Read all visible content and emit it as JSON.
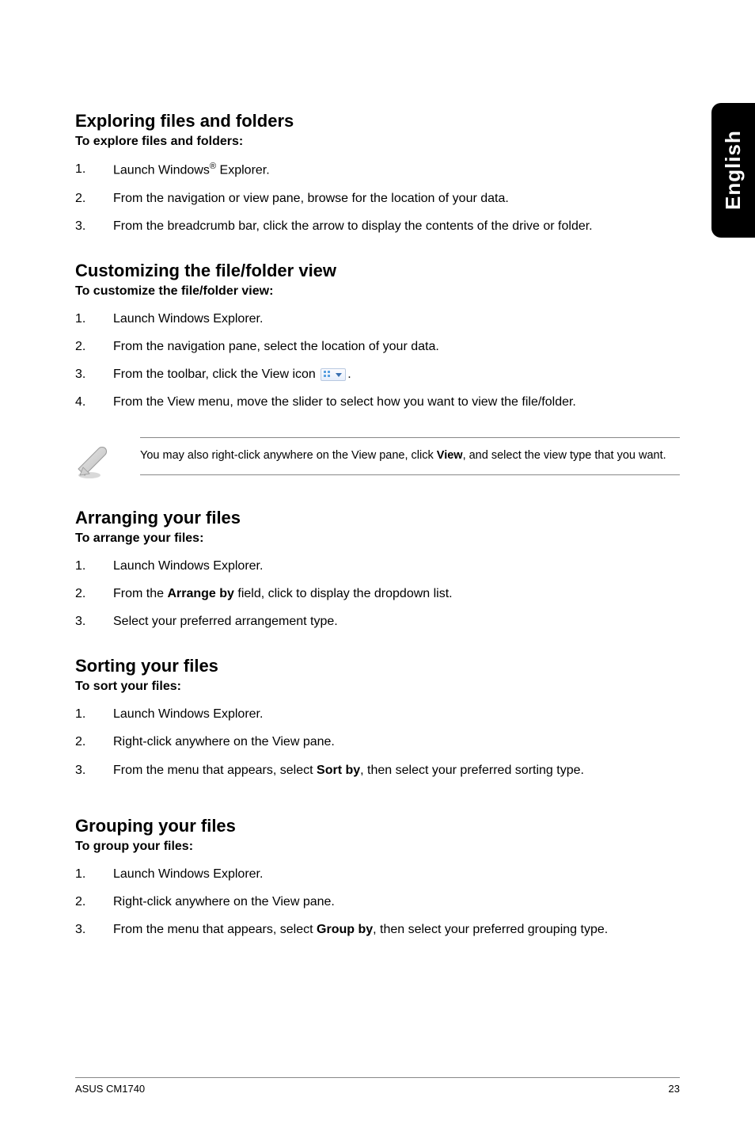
{
  "side_tab": "English",
  "sections": {
    "exploring": {
      "title": "Exploring files and folders",
      "lead": "To explore files and folders:",
      "steps": {
        "s1a": "Launch Windows",
        "s1b": " Explorer.",
        "s2": "From the navigation or view pane, browse for the location of your data.",
        "s3": "From the breadcrumb bar, click the arrow to display the contents of the drive or folder."
      }
    },
    "customizing": {
      "title": "Customizing the file/folder view",
      "lead": "To customize the file/folder view:",
      "steps": {
        "s1": "Launch Windows Explorer.",
        "s2": "From the navigation pane, select the location of your data.",
        "s3a": "From the toolbar, click the View icon ",
        "s3b": ".",
        "s4": "From the View menu, move the slider to select how you want to view the file/folder."
      }
    },
    "note": {
      "pre": "You may also right-click anywhere on the View pane, click ",
      "bold": "View",
      "post": ", and select the view type that you want."
    },
    "arranging": {
      "title": "Arranging your files",
      "lead": "To arrange your files:",
      "steps": {
        "s1": "Launch Windows Explorer.",
        "s2a": "From the ",
        "s2b": "Arrange by",
        "s2c": " field, click to display the dropdown list.",
        "s3": "Select your preferred arrangement type."
      }
    },
    "sorting": {
      "title": "Sorting your files",
      "lead": "To sort your files:",
      "steps": {
        "s1": "Launch Windows Explorer.",
        "s2": "Right-click anywhere on the View pane.",
        "s3a": "From the menu that appears, select ",
        "s3b": "Sort by",
        "s3c": ", then select your preferred sorting type."
      }
    },
    "grouping": {
      "title": "Grouping your files",
      "lead": "To group your files:",
      "steps": {
        "s1": "Launch Windows Explorer.",
        "s2": "Right-click anywhere on the View pane.",
        "s3a": "From the menu that appears, select ",
        "s3b": "Group by",
        "s3c": ", then select your preferred grouping type."
      }
    }
  },
  "footer": {
    "left": "ASUS CM1740",
    "right": "23"
  }
}
